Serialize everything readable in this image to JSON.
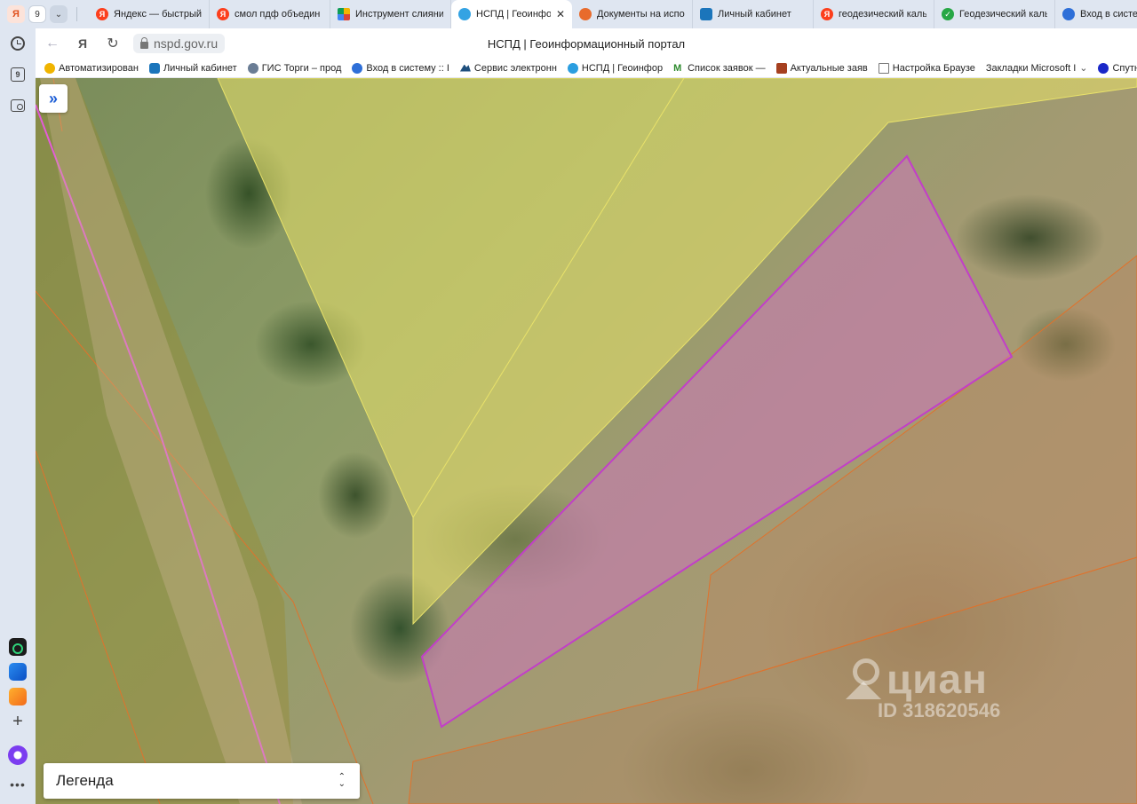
{
  "tabstrip": {
    "tab_count": "9",
    "tabs": [
      {
        "label": "Яндекс — быстрый",
        "favicon": "yandex-icon"
      },
      {
        "label": "смол пдф объедин",
        "favicon": "yandex-icon"
      },
      {
        "label": "Инструмент слияни",
        "favicon": "color-square-icon"
      },
      {
        "label": "НСПД | Геоинфор",
        "favicon": "nspd-icon",
        "active": true
      },
      {
        "label": "Документы на испо",
        "favicon": "orange-circle-icon"
      },
      {
        "label": "Личный кабинет",
        "favicon": "shield-icon"
      },
      {
        "label": "геодезический каль",
        "favicon": "yandex-icon"
      },
      {
        "label": "Геодезический каль",
        "favicon": "check-icon"
      },
      {
        "label": "Вход в систем",
        "favicon": "network-icon"
      }
    ]
  },
  "addressbar": {
    "url": "nspd.gov.ru",
    "page_title": "НСПД | Геоинформационный портал"
  },
  "bookmarks": [
    {
      "label": "Автоматизирован",
      "favicon": "smile-icon"
    },
    {
      "label": "Личный кабинет",
      "favicon": "shield-icon"
    },
    {
      "label": "ГИС Торги – прод",
      "favicon": "gis-icon"
    },
    {
      "label": "Вход в систему :: I",
      "favicon": "network-icon"
    },
    {
      "label": "Сервис электронн",
      "favicon": "cloud-icon"
    },
    {
      "label": "НСПД | Геоинфор",
      "favicon": "nspd-icon"
    },
    {
      "label": "Список заявок —",
      "favicon": "m-icon"
    },
    {
      "label": "Актуальные заяв",
      "favicon": "cube-icon"
    },
    {
      "label": "Настройка Браузе",
      "favicon": "doc-icon"
    },
    {
      "label": "Закладки Microsoft I",
      "favicon": "chevron-down-icon"
    },
    {
      "label": "Спутников",
      "favicon": "satellite-icon"
    }
  ],
  "map": {
    "watermark_brand": "циан",
    "watermark_id": "ID 318620546",
    "legend_label": "Легенда",
    "panel_toggle_symbol": "»",
    "colors": {
      "parcel_highlight": "#c23fc8",
      "parcel_fill": "#c77bb2",
      "yellow_zone": "#e9e26a",
      "boundary_orange": "#e0722c",
      "road_line": "#e45bd8"
    }
  }
}
